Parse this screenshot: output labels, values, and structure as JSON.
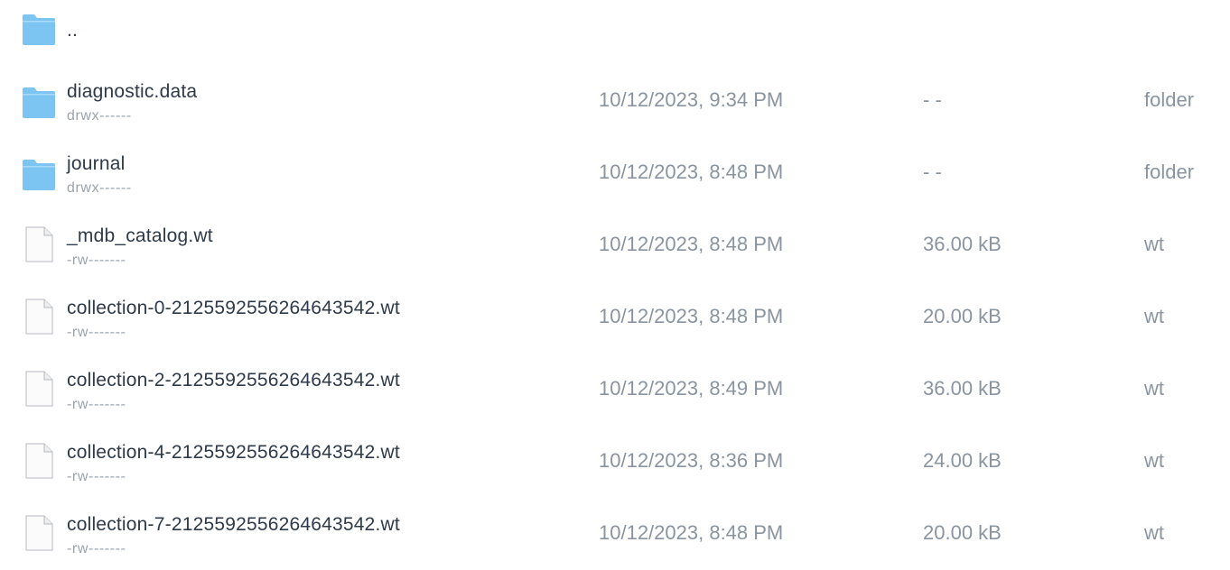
{
  "files": [
    {
      "name": "..",
      "permissions": "",
      "modified": "",
      "size": "",
      "kind": "",
      "icon": "folder-icon"
    },
    {
      "name": "diagnostic.data",
      "permissions": "drwx------",
      "modified": "10/12/2023, 9:34 PM",
      "size": "- -",
      "kind": "folder",
      "icon": "folder-icon"
    },
    {
      "name": "journal",
      "permissions": "drwx------",
      "modified": "10/12/2023, 8:48 PM",
      "size": "- -",
      "kind": "folder",
      "icon": "folder-icon"
    },
    {
      "name": "_mdb_catalog.wt",
      "permissions": "-rw-------",
      "modified": "10/12/2023, 8:48 PM",
      "size": "36.00 kB",
      "kind": "wt",
      "icon": "file-icon"
    },
    {
      "name": "collection-0-2125592556264643542.wt",
      "permissions": "-rw-------",
      "modified": "10/12/2023, 8:48 PM",
      "size": "20.00 kB",
      "kind": "wt",
      "icon": "file-icon"
    },
    {
      "name": "collection-2-2125592556264643542.wt",
      "permissions": "-rw-------",
      "modified": "10/12/2023, 8:49 PM",
      "size": "36.00 kB",
      "kind": "wt",
      "icon": "file-icon"
    },
    {
      "name": "collection-4-2125592556264643542.wt",
      "permissions": "-rw-------",
      "modified": "10/12/2023, 8:36 PM",
      "size": "24.00 kB",
      "kind": "wt",
      "icon": "file-icon"
    },
    {
      "name": "collection-7-2125592556264643542.wt",
      "permissions": "-rw-------",
      "modified": "10/12/2023, 8:48 PM",
      "size": "20.00 kB",
      "kind": "wt",
      "icon": "file-icon"
    }
  ],
  "colors": {
    "folder": "#7cc4f2",
    "name_text": "#2e3a4a",
    "meta_text": "#8a94a0",
    "permissions_text": "#9aa3ad"
  }
}
